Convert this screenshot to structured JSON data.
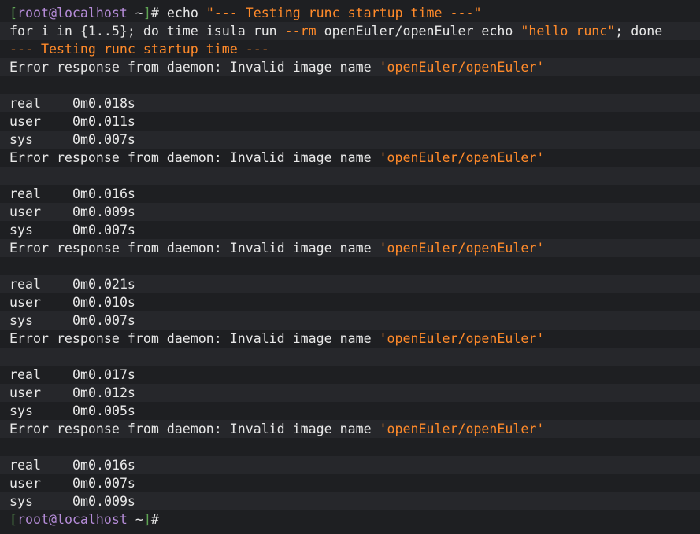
{
  "prompt": {
    "open": "[",
    "user_host": "root@localhost",
    "cwd": " ~",
    "close": "]",
    "symbol": "#"
  },
  "lines": [
    {
      "type": "cmd1",
      "pre": " echo ",
      "str": "\"--- Testing runc startup time ---\""
    },
    {
      "type": "cmd2",
      "a": "for i in {1..5}; do time isula run ",
      "flag": "--rm",
      "b": " openEuler/openEuler echo ",
      "str": "\"hello runc\"",
      "c": "; done"
    },
    {
      "type": "banner",
      "text": "--- Testing runc startup time ---"
    },
    {
      "type": "err",
      "text": "Error response from daemon: Invalid image name ",
      "str": "'openEuler/openEuler'"
    },
    {
      "type": "blank"
    },
    {
      "type": "time",
      "label": "real",
      "value": "0m0.018s"
    },
    {
      "type": "time",
      "label": "user",
      "value": "0m0.011s"
    },
    {
      "type": "time",
      "label": "sys",
      "value": "0m0.007s"
    },
    {
      "type": "err",
      "text": "Error response from daemon: Invalid image name ",
      "str": "'openEuler/openEuler'"
    },
    {
      "type": "blank"
    },
    {
      "type": "time",
      "label": "real",
      "value": "0m0.016s"
    },
    {
      "type": "time",
      "label": "user",
      "value": "0m0.009s"
    },
    {
      "type": "time",
      "label": "sys",
      "value": "0m0.007s"
    },
    {
      "type": "err",
      "text": "Error response from daemon: Invalid image name ",
      "str": "'openEuler/openEuler'"
    },
    {
      "type": "blank"
    },
    {
      "type": "time",
      "label": "real",
      "value": "0m0.021s"
    },
    {
      "type": "time",
      "label": "user",
      "value": "0m0.010s"
    },
    {
      "type": "time",
      "label": "sys",
      "value": "0m0.007s"
    },
    {
      "type": "err",
      "text": "Error response from daemon: Invalid image name ",
      "str": "'openEuler/openEuler'"
    },
    {
      "type": "blank"
    },
    {
      "type": "time",
      "label": "real",
      "value": "0m0.017s"
    },
    {
      "type": "time",
      "label": "user",
      "value": "0m0.012s"
    },
    {
      "type": "time",
      "label": "sys",
      "value": "0m0.005s"
    },
    {
      "type": "err",
      "text": "Error response from daemon: Invalid image name ",
      "str": "'openEuler/openEuler'"
    },
    {
      "type": "blank"
    },
    {
      "type": "time",
      "label": "real",
      "value": "0m0.016s"
    },
    {
      "type": "time",
      "label": "user",
      "value": "0m0.007s"
    },
    {
      "type": "time",
      "label": "sys",
      "value": "0m0.009s"
    },
    {
      "type": "prompt_only"
    }
  ],
  "colors": {
    "background": "#1e1f22",
    "alt_row": "#26272b",
    "text": "#e8e8e8",
    "string": "#ff8a2a",
    "bracket": "#5fa454",
    "host": "#b58cd8"
  }
}
